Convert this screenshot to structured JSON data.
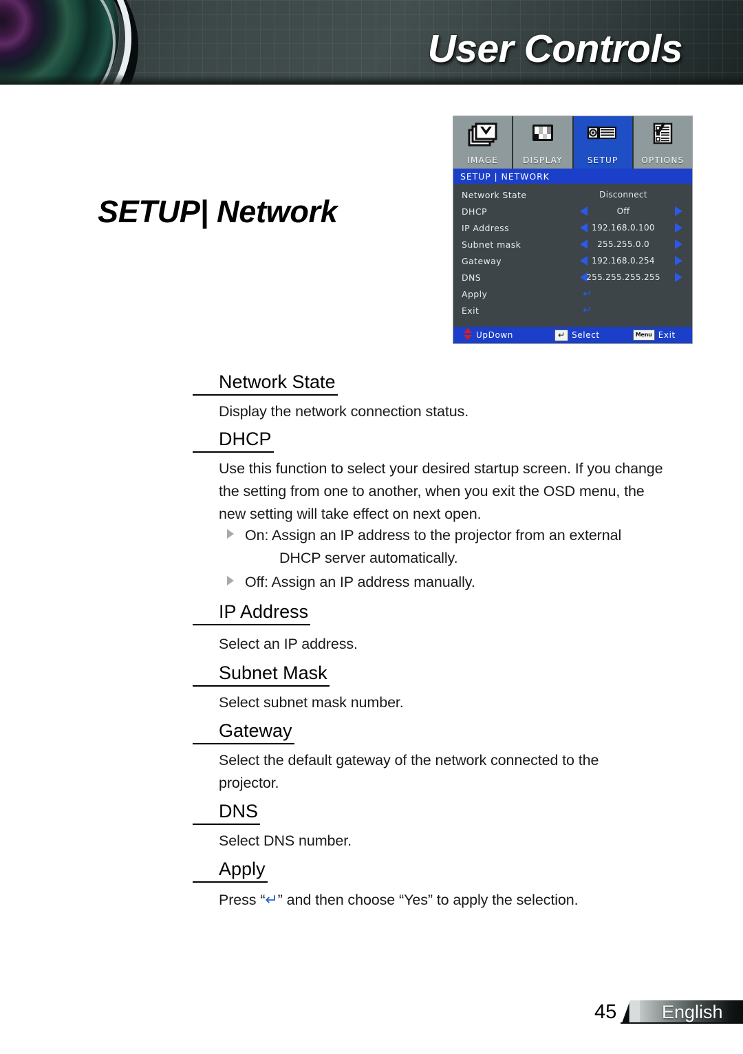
{
  "header": {
    "title": "User Controls",
    "lens_icon": "camera-lens-graphic"
  },
  "page": {
    "title_bold": "SETUP",
    "title_sep": "|",
    "title_rest": "Network"
  },
  "osd": {
    "tabs": [
      {
        "label": "IMAGE",
        "icon": "image-tab-icon",
        "active": false
      },
      {
        "label": "DISPLAY",
        "icon": "display-tab-icon",
        "active": false
      },
      {
        "label": "SETUP",
        "icon": "setup-projector-icon",
        "active": true
      },
      {
        "label": "OPTIONS",
        "icon": "options-checklist-icon",
        "active": false
      }
    ],
    "titlebar": "SETUP  |  NETWORK",
    "rows": [
      {
        "label": "Network State",
        "value": "Disconnect",
        "arrows": false,
        "enter": false
      },
      {
        "label": "DHCP",
        "value": "Off",
        "arrows": true,
        "enter": false
      },
      {
        "label": "IP Address",
        "value": "192.168.0.100",
        "arrows": true,
        "enter": false
      },
      {
        "label": "Subnet mask",
        "value": "255.255.0.0",
        "arrows": true,
        "enter": false
      },
      {
        "label": "Gateway",
        "value": "192.168.0.254",
        "arrows": true,
        "enter": false
      },
      {
        "label": "DNS",
        "value": "255.255.255.255",
        "arrows": true,
        "enter": false
      },
      {
        "label": "Apply",
        "value": "",
        "arrows": false,
        "enter": true
      },
      {
        "label": "Exit",
        "value": "",
        "arrows": false,
        "enter": true
      }
    ],
    "nav": {
      "updown_label": "UpDown",
      "updown_icon": "up-down-arrows-icon",
      "select_label": "Select",
      "select_key": "↵",
      "exit_label": "Exit",
      "exit_key": "Menu"
    },
    "colors": {
      "title_blue": "#1b3fc8",
      "body_gray": "#3d4549",
      "tab_gray": "#8e9a9b",
      "arrow_blue": "#2a5ae8",
      "updown_red": "#e01b1b"
    }
  },
  "sections": {
    "network_state": {
      "heading": "Network State",
      "body": "Display the network connection status."
    },
    "dhcp": {
      "heading": "DHCP",
      "body": "Use this function to select your desired startup screen. If you change the setting from one to another, when you exit the OSD menu, the new setting will take effect on next open.",
      "bullet_on": "On: Assign an IP address to the projector from an external",
      "bullet_on_cont": "DHCP server automatically.",
      "bullet_off": "Off: Assign an IP address manually."
    },
    "ip_address": {
      "heading": "IP Address",
      "body": "Select an IP address."
    },
    "subnet_mask": {
      "heading": "Subnet Mask",
      "body": "Select subnet mask number."
    },
    "gateway": {
      "heading": "Gateway",
      "body": "Select the default gateway of the network connected to the projector."
    },
    "dns": {
      "heading": "DNS",
      "body": "Select DNS number."
    },
    "apply": {
      "heading": "Apply",
      "body_pre": "Press “",
      "body_glyph": "↵",
      "body_post": "” and then choose “Yes” to apply the selection."
    }
  },
  "footer": {
    "page_number": "45",
    "language": "English"
  }
}
